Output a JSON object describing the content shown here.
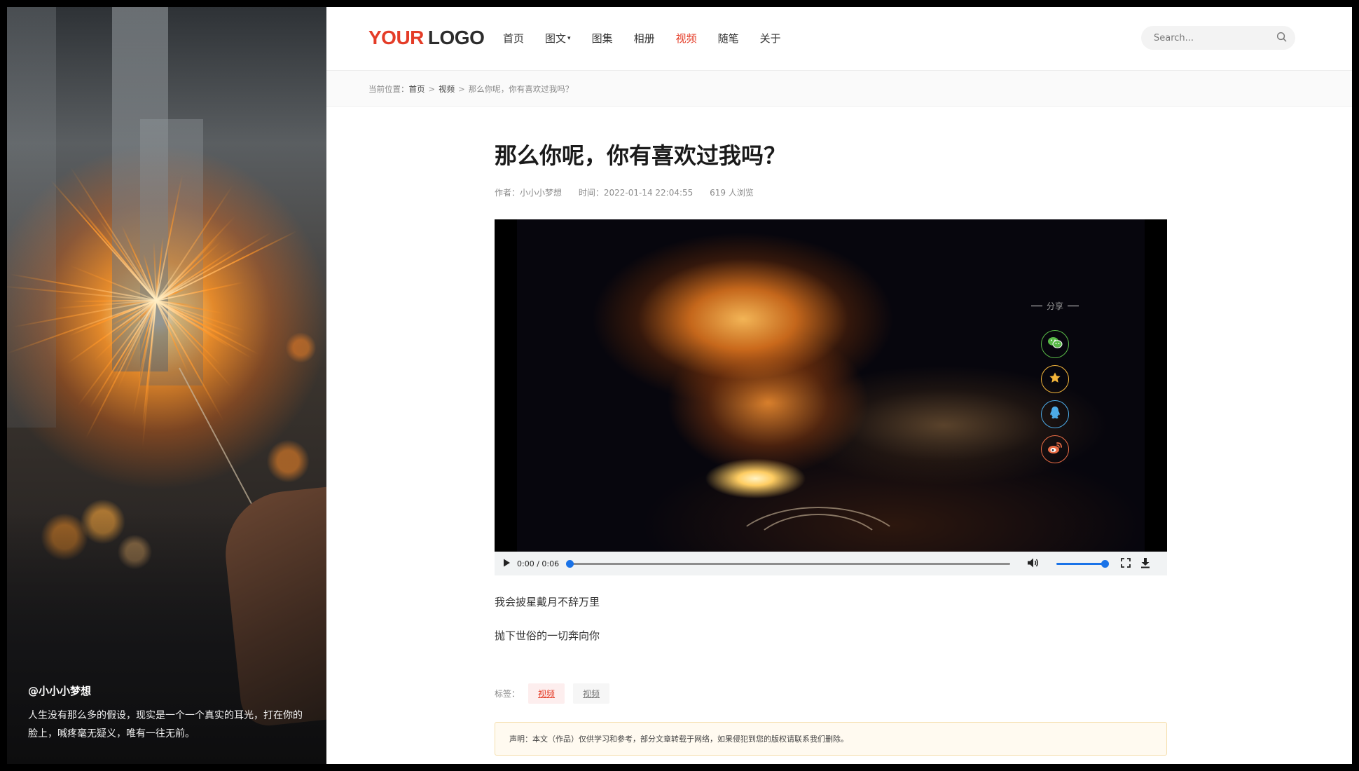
{
  "sidebar": {
    "author": "@小小小梦想",
    "quote": "人生没有那么多的假设，现实是一个一个真实的耳光，打在你的脸上，喊疼毫无疑义，唯有一往无前。"
  },
  "header": {
    "logo_part1": "YOUR",
    "logo_part2": "LOGO",
    "nav": [
      {
        "label": "首页"
      },
      {
        "label": "图文"
      },
      {
        "label": "图集"
      },
      {
        "label": "相册"
      },
      {
        "label": "视频",
        "active": true
      },
      {
        "label": "随笔"
      },
      {
        "label": "关于"
      }
    ],
    "search_placeholder": "Search..."
  },
  "breadcrumb": {
    "prefix": "当前位置：",
    "items": [
      "首页",
      "视频",
      "那么你呢，你有喜欢过我吗？"
    ]
  },
  "article": {
    "title": "那么你呢，你有喜欢过我吗？",
    "author": "作者：小小小梦想",
    "time": "时间：2022-01-14 22:04:55",
    "views": "619 人浏览",
    "video": {
      "time_display": "0:00 / 0:06",
      "progress": 0,
      "volume": 1.0
    },
    "paragraphs": [
      "我会披星戴月不辞万里",
      "抛下世俗的一切奔向你"
    ],
    "tags_label": "标签：",
    "tags": [
      "视频",
      "视频"
    ],
    "notice": "声明：本文（作品）仅供学习和参考，部分文章转载于网络，如果侵犯到您的版权请联系我们删除。"
  },
  "share": {
    "label": "分享",
    "buttons": [
      {
        "icon": "wechat-icon",
        "color": "#58b947"
      },
      {
        "icon": "favorite-star-icon",
        "color": "#f4b53a"
      },
      {
        "icon": "qq-icon",
        "color": "#4cabe8"
      },
      {
        "icon": "weibo-icon",
        "color": "#ea6c45"
      }
    ]
  },
  "colors": {
    "accent": "#e43c27",
    "player_accent": "#1a73e8"
  }
}
